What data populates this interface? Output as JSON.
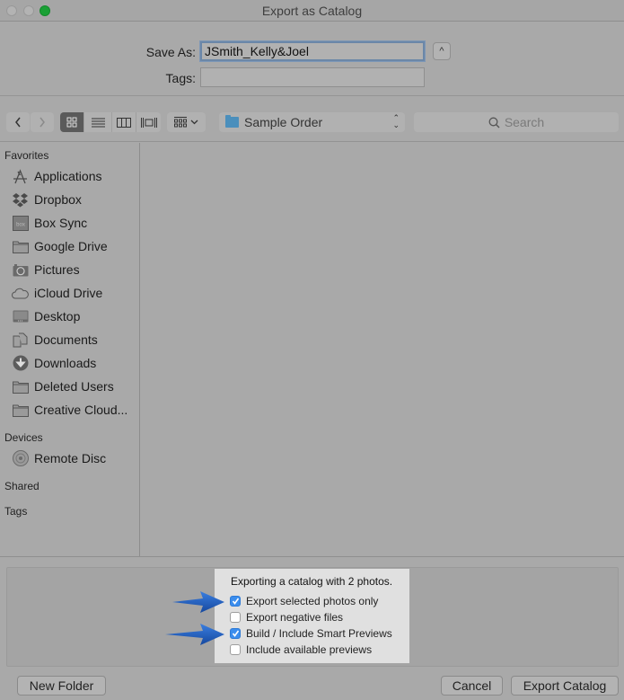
{
  "window": {
    "title": "Export as Catalog"
  },
  "save": {
    "save_as_label": "Save As:",
    "save_as_value": "JSmith_Kelly&Joel",
    "tags_label": "Tags:",
    "tags_value": "",
    "expand_icon": "chevron-up-icon"
  },
  "toolbar": {
    "back_icon": "chevron-left-icon",
    "forward_icon": "chevron-right-icon",
    "view_modes": [
      {
        "name": "icon-view",
        "active": true
      },
      {
        "name": "list-view",
        "active": false
      },
      {
        "name": "column-view",
        "active": false
      },
      {
        "name": "cover-flow-view",
        "active": false
      }
    ],
    "arrange_icon": "arrange-grid-icon",
    "location": "Sample Order",
    "search_placeholder": "Search"
  },
  "sidebar": {
    "favorites_header": "Favorites",
    "favorites": [
      {
        "label": "Applications",
        "icon": "applications-icon"
      },
      {
        "label": "Dropbox",
        "icon": "dropbox-icon"
      },
      {
        "label": "Box Sync",
        "icon": "box-icon"
      },
      {
        "label": "Google Drive",
        "icon": "folder-icon"
      },
      {
        "label": "Pictures",
        "icon": "camera-icon"
      },
      {
        "label": "iCloud Drive",
        "icon": "cloud-icon"
      },
      {
        "label": "Desktop",
        "icon": "desktop-icon"
      },
      {
        "label": "Documents",
        "icon": "documents-icon"
      },
      {
        "label": "Downloads",
        "icon": "download-icon"
      },
      {
        "label": "Deleted Users",
        "icon": "folder-icon"
      },
      {
        "label": "Creative Cloud...",
        "icon": "folder-icon"
      }
    ],
    "devices_header": "Devices",
    "devices": [
      {
        "label": "Remote Disc",
        "icon": "disc-icon"
      }
    ],
    "shared_header": "Shared",
    "tags_header": "Tags"
  },
  "options": {
    "title": "Exporting a catalog with 2 photos.",
    "items": [
      {
        "label": "Export selected photos only",
        "checked": true
      },
      {
        "label": "Export negative files",
        "checked": false
      },
      {
        "label": "Build / Include Smart Previews",
        "checked": true
      },
      {
        "label": "Include available previews",
        "checked": false
      }
    ],
    "accent": "#3b8ded",
    "annotation_arrow_color": "#1f5fc4"
  },
  "buttons": {
    "new_folder": "New Folder",
    "cancel": "Cancel",
    "export": "Export Catalog"
  }
}
